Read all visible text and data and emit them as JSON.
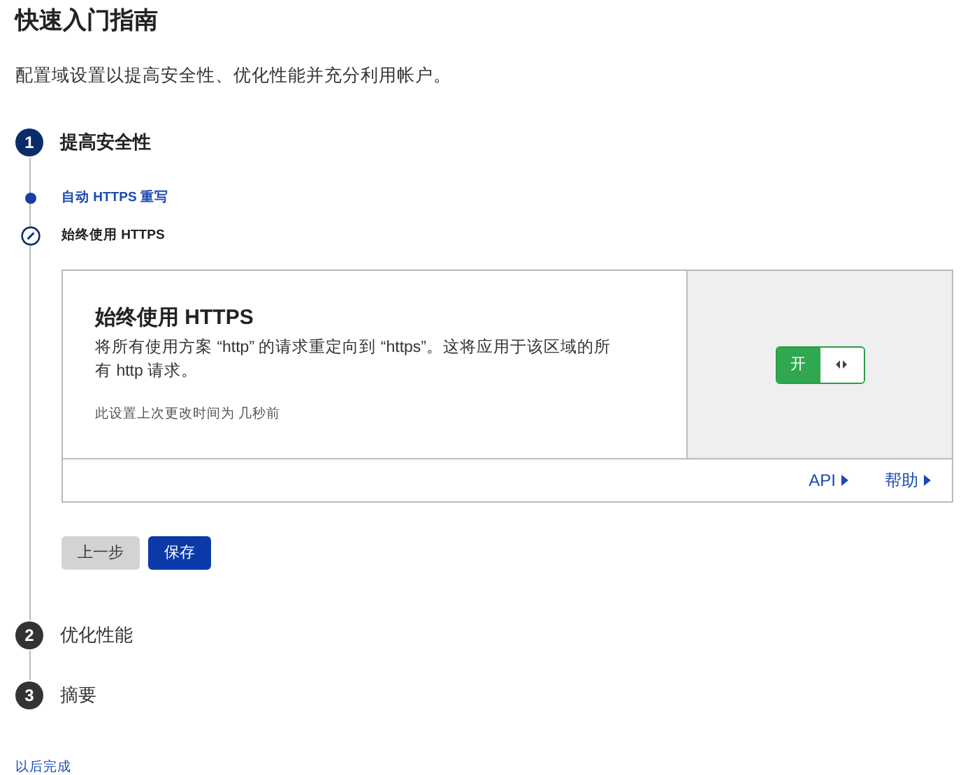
{
  "title": "快速入门指南",
  "subtitle": "配置域设置以提高安全性、优化性能并充分利用帐户。",
  "steps": [
    {
      "number": "1",
      "label": "提高安全性",
      "active": true,
      "substeps": [
        {
          "label": "自动 HTTPS 重写",
          "selected": false
        },
        {
          "label": "始终使用 HTTPS",
          "selected": true
        }
      ],
      "card": {
        "title": "始终使用 HTTPS",
        "description": "将所有使用方案 “http” 的请求重定向到 “https”。这将应用于该区域的所有 http 请求。",
        "meta": "此设置上次更改时间为 几秒前",
        "toggle": {
          "label": "开",
          "on": true
        },
        "links": [
          "API",
          "帮助"
        ]
      },
      "buttons": [
        {
          "label": "上一步",
          "kind": "secondary"
        },
        {
          "label": "保存",
          "kind": "primary"
        }
      ]
    },
    {
      "number": "2",
      "label": "优化性能",
      "active": false
    },
    {
      "number": "3",
      "label": "摘要",
      "active": false
    }
  ],
  "finish_link": "以后完成"
}
